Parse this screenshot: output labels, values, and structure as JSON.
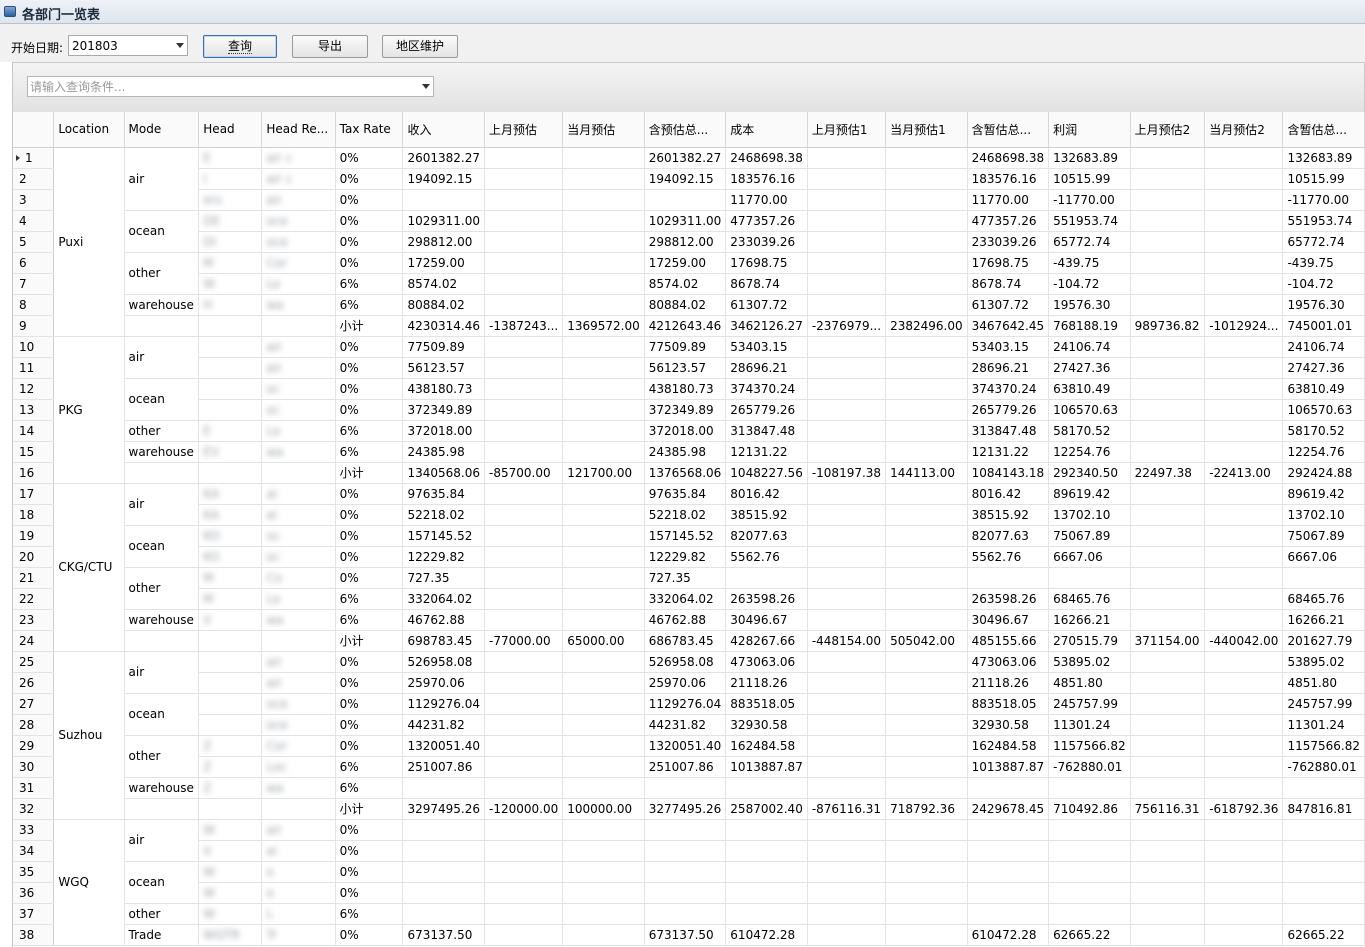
{
  "window": {
    "title": "各部门一览表"
  },
  "toolbar": {
    "start_date_label": "开始日期:",
    "start_date_value": "201803",
    "query_button": "查询",
    "export_button": "导出",
    "region_button": "地区维护"
  },
  "search": {
    "placeholder": "请输入查询条件..."
  },
  "columns": [
    "Location",
    "Mode",
    "Head",
    "Head Re...",
    "Tax Rate",
    "收入",
    "上月预估",
    "当月预估",
    "含预估总...",
    "成本",
    "上月预估1",
    "当月预估1",
    "含暂估总...",
    "利润",
    "上月预估2",
    "当月预估2",
    "含暂估总..."
  ],
  "groups": [
    {
      "location": "Puxi",
      "start": 0,
      "span": 9,
      "modes": [
        {
          "mode": "air",
          "start": 0,
          "span": 3
        },
        {
          "mode": "ocean",
          "start": 3,
          "span": 2
        },
        {
          "mode": "other",
          "start": 5,
          "span": 2
        },
        {
          "mode": "warehouse",
          "start": 7,
          "span": 1
        },
        {
          "mode": "",
          "start": 8,
          "span": 1
        }
      ]
    },
    {
      "location": "PKG",
      "start": 9,
      "span": 7,
      "modes": [
        {
          "mode": "air",
          "start": 9,
          "span": 2
        },
        {
          "mode": "ocean",
          "start": 11,
          "span": 2
        },
        {
          "mode": "other",
          "start": 13,
          "span": 1
        },
        {
          "mode": "warehouse",
          "start": 14,
          "span": 1
        },
        {
          "mode": "",
          "start": 15,
          "span": 1
        }
      ]
    },
    {
      "location": "CKG/CTU",
      "start": 16,
      "span": 8,
      "modes": [
        {
          "mode": "air",
          "start": 16,
          "span": 2
        },
        {
          "mode": "ocean",
          "start": 18,
          "span": 2
        },
        {
          "mode": "other",
          "start": 20,
          "span": 2
        },
        {
          "mode": "warehouse",
          "start": 22,
          "span": 1
        },
        {
          "mode": "",
          "start": 23,
          "span": 1
        }
      ]
    },
    {
      "location": "Suzhou",
      "start": 24,
      "span": 8,
      "modes": [
        {
          "mode": "air",
          "start": 24,
          "span": 2
        },
        {
          "mode": "ocean",
          "start": 26,
          "span": 2
        },
        {
          "mode": "other",
          "start": 28,
          "span": 2
        },
        {
          "mode": "warehouse",
          "start": 30,
          "span": 1
        },
        {
          "mode": "",
          "start": 31,
          "span": 1
        }
      ]
    },
    {
      "location": "WGQ",
      "start": 32,
      "span": 6,
      "modes": [
        {
          "mode": "air",
          "start": 32,
          "span": 2
        },
        {
          "mode": "ocean",
          "start": 34,
          "span": 2
        },
        {
          "mode": "other",
          "start": 36,
          "span": 1
        },
        {
          "mode": "Trade",
          "start": 37,
          "span": 1
        }
      ]
    }
  ],
  "rows": [
    {
      "n": "1",
      "head": "E",
      "headRe": "air c",
      "tax": "0%",
      "v": [
        "2601382.27",
        "",
        "",
        "2601382.27",
        "2468698.38",
        "",
        "",
        "2468698.38",
        "132683.89",
        "",
        "",
        "132683.89"
      ]
    },
    {
      "n": "2",
      "head": "I",
      "headRe": "air c",
      "tax": "0%",
      "v": [
        "194092.15",
        "",
        "",
        "194092.15",
        "183576.16",
        "",
        "",
        "183576.16",
        "10515.99",
        "",
        "",
        "10515.99"
      ]
    },
    {
      "n": "3",
      "head": "ers",
      "headRe": "air",
      "tax": "0%",
      "v": [
        "",
        "",
        "",
        "",
        "11770.00",
        "",
        "",
        "11770.00",
        "-11770.00",
        "",
        "",
        "-11770.00"
      ]
    },
    {
      "n": "4",
      "head": "DE",
      "headRe": "oce",
      "tax": "0%",
      "v": [
        "1029311.00",
        "",
        "",
        "1029311.00",
        "477357.26",
        "",
        "",
        "477357.26",
        "551953.74",
        "",
        "",
        "551953.74"
      ]
    },
    {
      "n": "5",
      "head": "DI",
      "headRe": "oce",
      "tax": "0%",
      "v": [
        "298812.00",
        "",
        "",
        "298812.00",
        "233039.26",
        "",
        "",
        "233039.26",
        "65772.74",
        "",
        "",
        "65772.74"
      ]
    },
    {
      "n": "6",
      "head": "M",
      "headRe": "Cor",
      "tax": "0%",
      "v": [
        "17259.00",
        "",
        "",
        "17259.00",
        "17698.75",
        "",
        "",
        "17698.75",
        "-439.75",
        "",
        "",
        "-439.75"
      ]
    },
    {
      "n": "7",
      "head": "W",
      "headRe": "Lo",
      "tax": "6%",
      "v": [
        "8574.02",
        "",
        "",
        "8574.02",
        "8678.74",
        "",
        "",
        "8678.74",
        "-104.72",
        "",
        "",
        "-104.72"
      ]
    },
    {
      "n": "8",
      "head": "H",
      "headRe": "wa",
      "tax": "6%",
      "v": [
        "80884.02",
        "",
        "",
        "80884.02",
        "61307.72",
        "",
        "",
        "61307.72",
        "19576.30",
        "",
        "",
        "19576.30"
      ]
    },
    {
      "n": "9",
      "head": "",
      "headRe": "",
      "tax": "小计",
      "v": [
        "4230314.46",
        "-1387243...",
        "1369572.00",
        "4212643.46",
        "3462126.27",
        "-2376979...",
        "2382496.00",
        "3467642.45",
        "768188.19",
        "989736.82",
        "-1012924...",
        "745001.01"
      ]
    },
    {
      "n": "10",
      "head": "",
      "headRe": "air",
      "tax": "0%",
      "v": [
        "77509.89",
        "",
        "",
        "77509.89",
        "53403.15",
        "",
        "",
        "53403.15",
        "24106.74",
        "",
        "",
        "24106.74"
      ]
    },
    {
      "n": "11",
      "head": "",
      "headRe": "air",
      "tax": "0%",
      "v": [
        "56123.57",
        "",
        "",
        "56123.57",
        "28696.21",
        "",
        "",
        "28696.21",
        "27427.36",
        "",
        "",
        "27427.36"
      ]
    },
    {
      "n": "12",
      "head": "",
      "headRe": "oc",
      "tax": "0%",
      "v": [
        "438180.73",
        "",
        "",
        "438180.73",
        "374370.24",
        "",
        "",
        "374370.24",
        "63810.49",
        "",
        "",
        "63810.49"
      ]
    },
    {
      "n": "13",
      "head": "",
      "headRe": "oc",
      "tax": "0%",
      "v": [
        "372349.89",
        "",
        "",
        "372349.89",
        "265779.26",
        "",
        "",
        "265779.26",
        "106570.63",
        "",
        "",
        "106570.63"
      ]
    },
    {
      "n": "14",
      "head": "E",
      "headRe": "Lo",
      "tax": "6%",
      "v": [
        "372018.00",
        "",
        "",
        "372018.00",
        "313847.48",
        "",
        "",
        "313847.48",
        "58170.52",
        "",
        "",
        "58170.52"
      ]
    },
    {
      "n": "15",
      "head": "EV",
      "headRe": "wa",
      "tax": "6%",
      "v": [
        "24385.98",
        "",
        "",
        "24385.98",
        "12131.22",
        "",
        "",
        "12131.22",
        "12254.76",
        "",
        "",
        "12254.76"
      ]
    },
    {
      "n": "16",
      "head": "",
      "headRe": "",
      "tax": "小计",
      "v": [
        "1340568.06",
        "-85700.00",
        "121700.00",
        "1376568.06",
        "1048227.56",
        "-108197.38",
        "144113.00",
        "1084143.18",
        "292340.50",
        "22497.38",
        "-22413.00",
        "292424.88"
      ]
    },
    {
      "n": "17",
      "head": "KA",
      "headRe": "ai",
      "tax": "0%",
      "v": [
        "97635.84",
        "",
        "",
        "97635.84",
        "8016.42",
        "",
        "",
        "8016.42",
        "89619.42",
        "",
        "",
        "89619.42"
      ]
    },
    {
      "n": "18",
      "head": "KA",
      "headRe": "ai",
      "tax": "0%",
      "v": [
        "52218.02",
        "",
        "",
        "52218.02",
        "38515.92",
        "",
        "",
        "38515.92",
        "13702.10",
        "",
        "",
        "13702.10"
      ]
    },
    {
      "n": "19",
      "head": "KO",
      "headRe": "oc",
      "tax": "0%",
      "v": [
        "157145.52",
        "",
        "",
        "157145.52",
        "82077.63",
        "",
        "",
        "82077.63",
        "75067.89",
        "",
        "",
        "75067.89"
      ]
    },
    {
      "n": "20",
      "head": "KO",
      "headRe": "oc",
      "tax": "0%",
      "v": [
        "12229.82",
        "",
        "",
        "12229.82",
        "5562.76",
        "",
        "",
        "5562.76",
        "6667.06",
        "",
        "",
        "6667.06"
      ]
    },
    {
      "n": "21",
      "head": "M",
      "headRe": "Co",
      "tax": "0%",
      "v": [
        "727.35",
        "",
        "",
        "727.35",
        "",
        "",
        "",
        "",
        "",
        "",
        "",
        ""
      ]
    },
    {
      "n": "22",
      "head": "M",
      "headRe": "Lo",
      "tax": "6%",
      "v": [
        "332064.02",
        "",
        "",
        "332064.02",
        "263598.26",
        "",
        "",
        "263598.26",
        "68465.76",
        "",
        "",
        "68465.76"
      ]
    },
    {
      "n": "23",
      "head": "V",
      "headRe": "wa",
      "tax": "6%",
      "v": [
        "46762.88",
        "",
        "",
        "46762.88",
        "30496.67",
        "",
        "",
        "30496.67",
        "16266.21",
        "",
        "",
        "16266.21"
      ]
    },
    {
      "n": "24",
      "head": "",
      "headRe": "",
      "tax": "小计",
      "v": [
        "698783.45",
        "-77000.00",
        "65000.00",
        "686783.45",
        "428267.66",
        "-448154.00",
        "505042.00",
        "485155.66",
        "270515.79",
        "371154.00",
        "-440042.00",
        "201627.79"
      ]
    },
    {
      "n": "25",
      "head": "",
      "headRe": "air",
      "tax": "0%",
      "v": [
        "526958.08",
        "",
        "",
        "526958.08",
        "473063.06",
        "",
        "",
        "473063.06",
        "53895.02",
        "",
        "",
        "53895.02"
      ]
    },
    {
      "n": "26",
      "head": "",
      "headRe": "air",
      "tax": "0%",
      "v": [
        "25970.06",
        "",
        "",
        "25970.06",
        "21118.26",
        "",
        "",
        "21118.26",
        "4851.80",
        "",
        "",
        "4851.80"
      ]
    },
    {
      "n": "27",
      "head": "",
      "headRe": "oce",
      "tax": "0%",
      "v": [
        "1129276.04",
        "",
        "",
        "1129276.04",
        "883518.05",
        "",
        "",
        "883518.05",
        "245757.99",
        "",
        "",
        "245757.99"
      ]
    },
    {
      "n": "28",
      "head": "",
      "headRe": "oce",
      "tax": "0%",
      "v": [
        "44231.82",
        "",
        "",
        "44231.82",
        "32930.58",
        "",
        "",
        "32930.58",
        "11301.24",
        "",
        "",
        "11301.24"
      ]
    },
    {
      "n": "29",
      "head": "Z",
      "headRe": "Cor",
      "tax": "0%",
      "v": [
        "1320051.40",
        "",
        "",
        "1320051.40",
        "162484.58",
        "",
        "",
        "162484.58",
        "1157566.82",
        "",
        "",
        "1157566.82"
      ]
    },
    {
      "n": "30",
      "head": "Z",
      "headRe": "Loc",
      "tax": "6%",
      "v": [
        "251007.86",
        "",
        "",
        "251007.86",
        "1013887.87",
        "",
        "",
        "1013887.87",
        "-762880.01",
        "",
        "",
        "-762880.01"
      ]
    },
    {
      "n": "31",
      "head": "Z",
      "headRe": "wa",
      "tax": "6%",
      "v": [
        "",
        "",
        "",
        "",
        "",
        "",
        "",
        "",
        "",
        "",
        "",
        ""
      ]
    },
    {
      "n": "32",
      "head": "",
      "headRe": "",
      "tax": "小计",
      "v": [
        "3297495.26",
        "-120000.00",
        "100000.00",
        "3277495.26",
        "2587002.40",
        "-876116.31",
        "718792.36",
        "2429678.45",
        "710492.86",
        "756116.31",
        "-618792.36",
        "847816.81"
      ]
    },
    {
      "n": "33",
      "head": "W",
      "headRe": "air",
      "tax": "0%",
      "v": [
        "",
        "",
        "",
        "",
        "",
        "",
        "",
        "",
        "",
        "",
        "",
        ""
      ]
    },
    {
      "n": "34",
      "head": "V",
      "headRe": "ai",
      "tax": "0%",
      "v": [
        "",
        "",
        "",
        "",
        "",
        "",
        "",
        "",
        "",
        "",
        "",
        ""
      ]
    },
    {
      "n": "35",
      "head": "W",
      "headRe": "o",
      "tax": "0%",
      "v": [
        "",
        "",
        "",
        "",
        "",
        "",
        "",
        "",
        "",
        "",
        "",
        ""
      ]
    },
    {
      "n": "36",
      "head": "W",
      "headRe": "o",
      "tax": "0%",
      "v": [
        "",
        "",
        "",
        "",
        "",
        "",
        "",
        "",
        "",
        "",
        "",
        ""
      ]
    },
    {
      "n": "37",
      "head": "W",
      "headRe": "L",
      "tax": "6%",
      "v": [
        "",
        "",
        "",
        "",
        "",
        "",
        "",
        "",
        "",
        "",
        "",
        ""
      ]
    },
    {
      "n": "38",
      "head": "WGTR",
      "headRe": "Tr",
      "tax": "0%",
      "v": [
        "673137.50",
        "",
        "",
        "673137.50",
        "610472.28",
        "",
        "",
        "610472.28",
        "62665.22",
        "",
        "",
        "62665.22"
      ]
    }
  ]
}
